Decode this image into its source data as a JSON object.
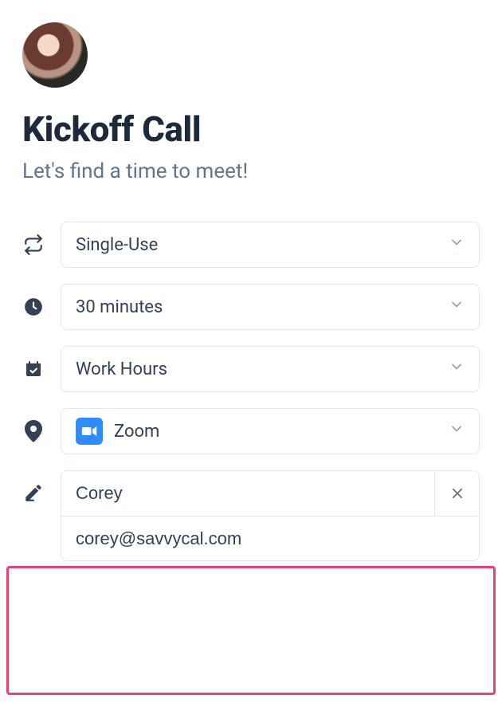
{
  "title": "Kickoff Call",
  "subtitle": "Let's find a time to meet!",
  "options": {
    "usage": "Single-Use",
    "duration": "30 minutes",
    "availability": "Work Hours",
    "location": "Zoom"
  },
  "invitee": {
    "name": "Corey",
    "email": "corey@savvycal.com"
  }
}
